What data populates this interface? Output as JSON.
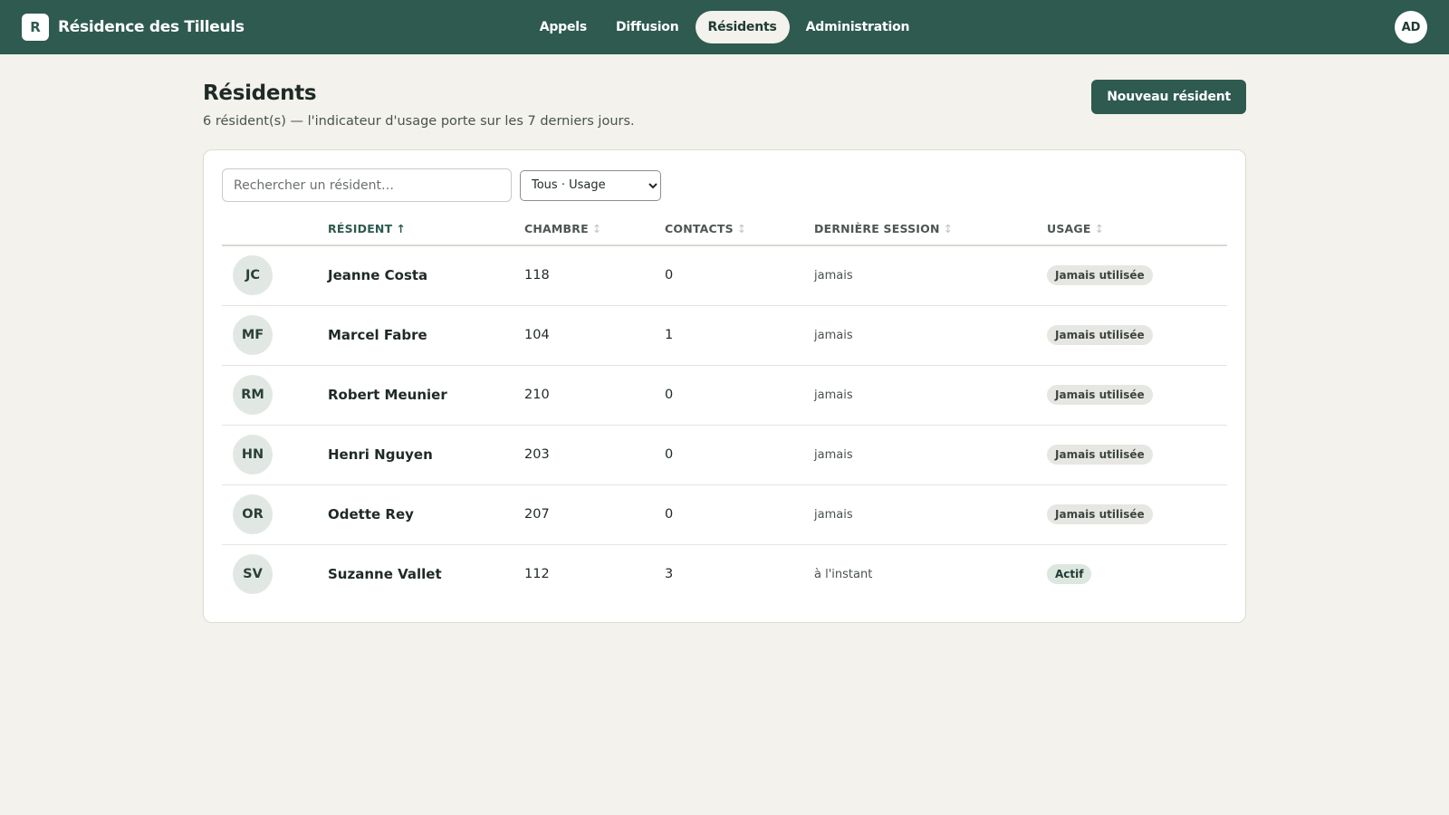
{
  "app": {
    "logo_letter": "R",
    "name": "Résidence des Tilleuls"
  },
  "nav": {
    "items": [
      {
        "label": "Appels"
      },
      {
        "label": "Diffusion"
      },
      {
        "label": "Résidents"
      },
      {
        "label": "Administration"
      }
    ],
    "active": "Résidents"
  },
  "user": {
    "initials": "AD"
  },
  "page": {
    "title": "Résidents",
    "subtitle": "6 résident(s) — l'indicateur d'usage porte sur les 7 derniers jours.",
    "new_button": "Nouveau résident"
  },
  "filters": {
    "search_placeholder": "Rechercher un résident…",
    "usage_selected": "Tous · Usage"
  },
  "table": {
    "headers": {
      "resident": "RÉSIDENT",
      "room": "CHAMBRE",
      "contacts": "CONTACTS",
      "last_session": "DERNIÈRE SESSION",
      "usage": "USAGE"
    },
    "sort_active_indicator": "↑",
    "sort_inactive_indicator": "↕",
    "rows": [
      {
        "initials": "JC",
        "name": "Jeanne Costa",
        "room": "118",
        "contacts": "0",
        "last_session": "jamais",
        "usage": "Jamais utilisée"
      },
      {
        "initials": "MF",
        "name": "Marcel Fabre",
        "room": "104",
        "contacts": "1",
        "last_session": "jamais",
        "usage": "Jamais utilisée"
      },
      {
        "initials": "RM",
        "name": "Robert Meunier",
        "room": "210",
        "contacts": "0",
        "last_session": "jamais",
        "usage": "Jamais utilisée"
      },
      {
        "initials": "HN",
        "name": "Henri Nguyen",
        "room": "203",
        "contacts": "0",
        "last_session": "jamais",
        "usage": "Jamais utilisée"
      },
      {
        "initials": "OR",
        "name": "Odette Rey",
        "room": "207",
        "contacts": "0",
        "last_session": "jamais",
        "usage": "Jamais utilisée"
      },
      {
        "initials": "SV",
        "name": "Suzanne Vallet",
        "room": "112",
        "contacts": "3",
        "last_session": "à l'instant",
        "usage": "Actif"
      }
    ]
  },
  "colors": {
    "brand": "#2e5a4f",
    "background": "#f3f2ec",
    "badge_neutral": "#e6e7e2",
    "badge_active": "#dce7df"
  }
}
